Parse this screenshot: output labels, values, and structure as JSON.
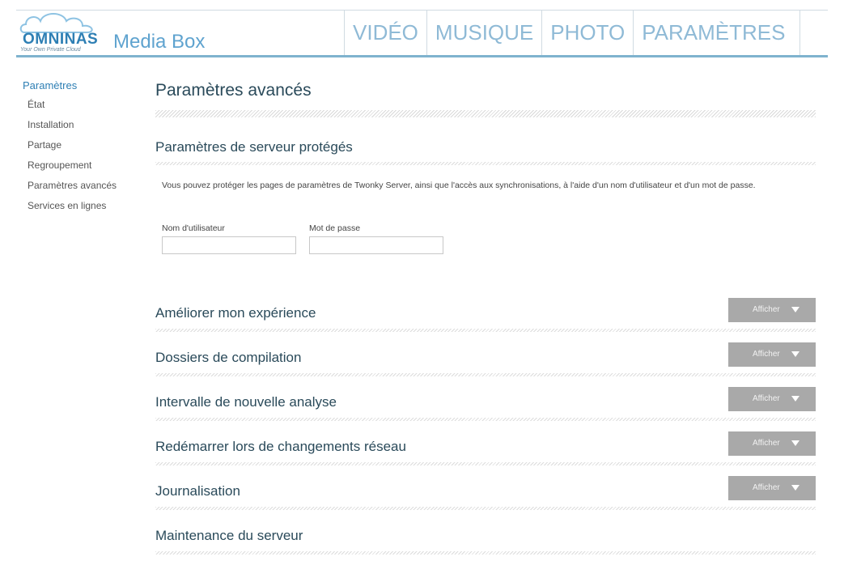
{
  "header": {
    "logo_text": "OMNINAS",
    "logo_tagline": "Your Own Private Cloud",
    "app_title": "Media Box",
    "nav": [
      "VIDÉO",
      "MUSIQUE",
      "PHOTO",
      "PARAMÈTRES"
    ]
  },
  "sidebar": {
    "title": "Paramètres",
    "items": [
      "État",
      "Installation",
      "Partage",
      "Regroupement",
      "Paramètres avancés",
      "Services en lignes"
    ]
  },
  "main": {
    "page_title": "Paramètres avancés",
    "protected": {
      "title": "Paramètres de serveur protégés",
      "description": "Vous pouvez protéger les pages de paramètres de Twonky Server, ainsi que l'accès aux synchronisations, à l'aide d'un nom d'utilisateur et d'un mot de passe.",
      "username_label": "Nom d'utilisateur",
      "password_label": "Mot de passe",
      "username_value": "",
      "password_value": ""
    },
    "sections": [
      {
        "title": "Améliorer mon expérience",
        "button": "Afficher"
      },
      {
        "title": "Dossiers de compilation",
        "button": "Afficher"
      },
      {
        "title": "Intervalle de nouvelle analyse",
        "button": "Afficher"
      },
      {
        "title": "Redémarrer lors de changements réseau",
        "button": "Afficher"
      },
      {
        "title": "Journalisation",
        "button": "Afficher"
      },
      {
        "title": "Maintenance du serveur"
      }
    ]
  },
  "colors": {
    "accent": "#2e7fb4",
    "nav_text": "#8fbad6",
    "header_rule": "#7fb3ce",
    "button_bg": "#a9a9a9"
  }
}
